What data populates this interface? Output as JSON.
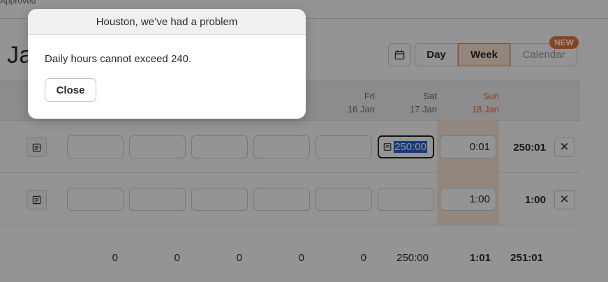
{
  "status": {
    "approved_label": "Approved"
  },
  "page": {
    "title": "Jan"
  },
  "view_toggle": {
    "day": "Day",
    "week": "Week",
    "calendar": "Calendar",
    "new_badge": "NEW",
    "active": "Week"
  },
  "days": [
    {
      "name": "Fri",
      "date": "16 Jan"
    },
    {
      "name": "Sat",
      "date": "17 Jan"
    },
    {
      "name": "Sun",
      "date": "18 Jan"
    }
  ],
  "rows": [
    {
      "sat": "250:00",
      "sun": "0:01",
      "total": "250:01"
    },
    {
      "sat": "",
      "sun": "1:00",
      "total": "1:00"
    }
  ],
  "totals": {
    "d1": "0",
    "d2": "0",
    "d3": "0",
    "d4": "0",
    "d5": "0",
    "sat": "250:00",
    "sun": "1:01",
    "grand": "251:01"
  },
  "dialog": {
    "title": "Houston, we’ve had a problem",
    "message": "Daily hours cannot exceed 240.",
    "close_label": "Close"
  },
  "colors": {
    "accent": "#e8743c",
    "overlay": "rgba(0,0,0,0.42)"
  },
  "icons": {
    "calendar": "calendar-icon",
    "note": "note-icon",
    "delete": "close-icon"
  }
}
